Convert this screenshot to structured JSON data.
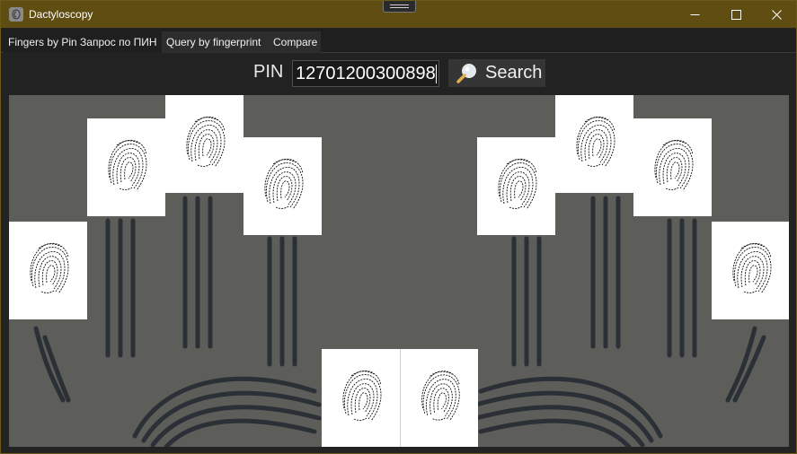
{
  "window": {
    "title": "Dactyloscopy",
    "accent_color": "#5f4d12"
  },
  "tabs": [
    {
      "label": "Fingers by Pin Запрос по ПИН",
      "selected": true
    },
    {
      "label": "Query by fingerprint",
      "selected": false
    },
    {
      "label": "Compare",
      "selected": false
    }
  ],
  "search": {
    "pin_label": "PIN",
    "pin_value": "12701200300898",
    "button_label": "Search",
    "button_icon": "magnifier-icon"
  },
  "fingerprints": [
    {
      "hand": "left",
      "finger": "pinky"
    },
    {
      "hand": "left",
      "finger": "ring"
    },
    {
      "hand": "left",
      "finger": "middle"
    },
    {
      "hand": "left",
      "finger": "index"
    },
    {
      "hand": "left",
      "finger": "thumb"
    },
    {
      "hand": "right",
      "finger": "thumb"
    },
    {
      "hand": "right",
      "finger": "index"
    },
    {
      "hand": "right",
      "finger": "middle"
    },
    {
      "hand": "right",
      "finger": "ring"
    },
    {
      "hand": "right",
      "finger": "pinky"
    }
  ]
}
